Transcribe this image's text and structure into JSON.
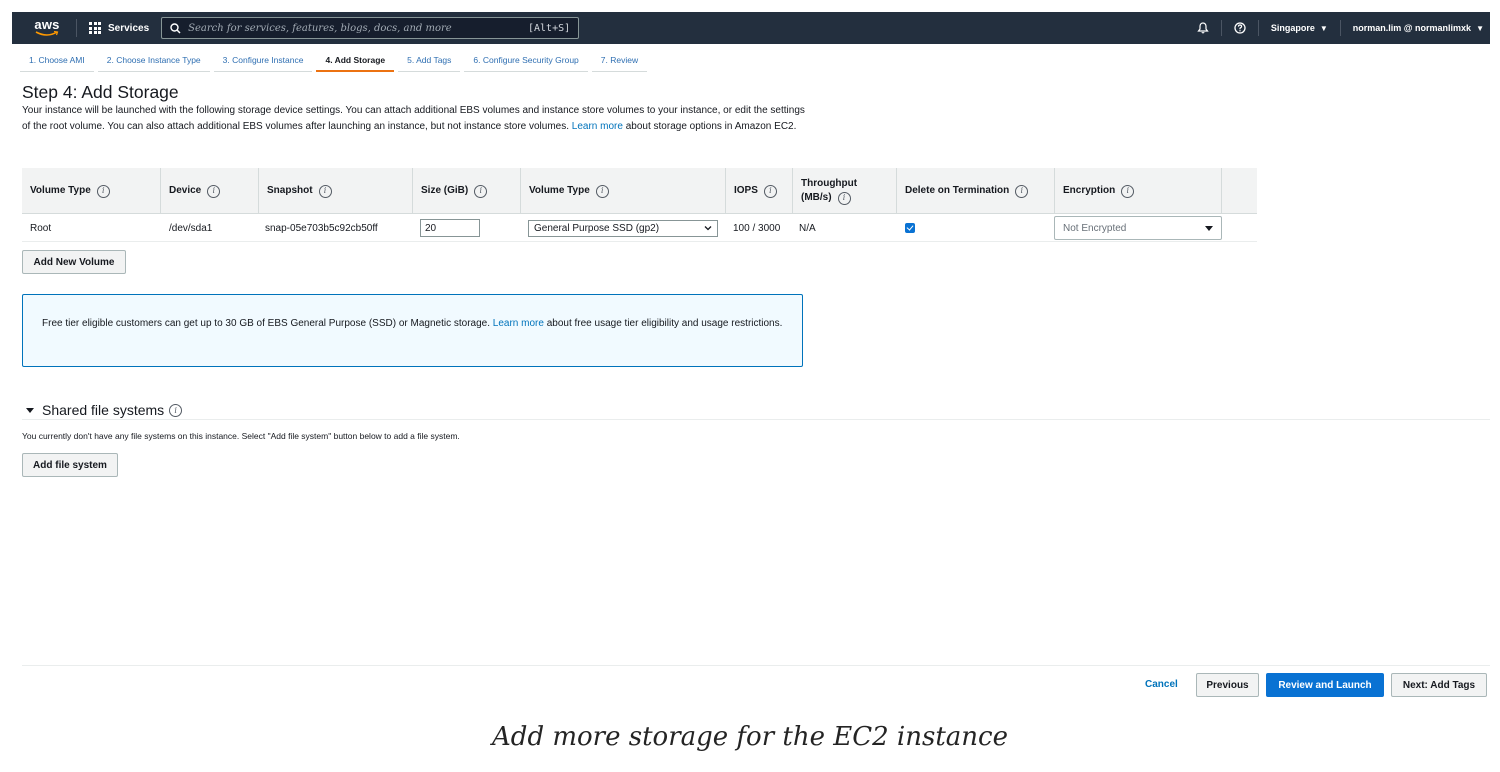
{
  "topnav": {
    "logo_text": "aws",
    "services_label": "Services",
    "search_placeholder": "Search for services, features, blogs, docs, and more",
    "search_shortcut": "[Alt+S]",
    "region": "Singapore",
    "account": "norman.lim @ normanlimxk"
  },
  "wizard": {
    "tabs": [
      {
        "label": "1. Choose AMI"
      },
      {
        "label": "2. Choose Instance Type"
      },
      {
        "label": "3. Configure Instance"
      },
      {
        "label": "4. Add Storage"
      },
      {
        "label": "5. Add Tags"
      },
      {
        "label": "6. Configure Security Group"
      },
      {
        "label": "7. Review"
      }
    ],
    "active_index": 3
  },
  "page": {
    "title": "Step 4: Add Storage",
    "intro": "Your instance will be launched with the following storage device settings. You can attach additional EBS volumes and instance store volumes to your instance, or edit the settings of the root volume. You can also attach additional EBS volumes after launching an instance, but not instance store volumes.",
    "intro_link": "Learn more",
    "intro_tail": "about storage options in Amazon EC2."
  },
  "storage_table": {
    "headers": {
      "volume_type": "Volume Type",
      "device": "Device",
      "snapshot": "Snapshot",
      "size": "Size (GiB)",
      "volume_type2": "Volume Type",
      "iops": "IOPS",
      "throughput_1": "Throughput",
      "throughput_2": "(MB/s)",
      "delete_on_termination": "Delete on Termination",
      "encryption": "Encryption"
    },
    "rows": [
      {
        "volume_type": "Root",
        "device": "/dev/sda1",
        "snapshot": "snap-05e703b5c92cb50ff",
        "size": "20",
        "volume_type_select": "General Purpose SSD (gp2)",
        "iops": "100 / 3000",
        "throughput": "N/A",
        "delete_on_termination": true,
        "encryption": "Not Encrypted"
      }
    ],
    "info_glyph": "i"
  },
  "buttons": {
    "add_new_volume": "Add New Volume",
    "add_file_system": "Add file system",
    "cancel": "Cancel",
    "previous": "Previous",
    "review_and_launch": "Review and Launch",
    "next": "Next: Add Tags"
  },
  "notice": {
    "text": "Free tier eligible customers can get up to 30 GB of EBS General Purpose (SSD) or Magnetic storage.",
    "link": "Learn more",
    "tail": "about free usage tier eligibility and usage restrictions."
  },
  "shared_fs": {
    "title": "Shared file systems",
    "message": "You currently don't have any file systems on this instance. Select \"Add file system\" button below to add a file system."
  },
  "caption": "Add more storage for the EC2 instance",
  "colors": {
    "nav_bg": "#232f3e",
    "accent_orange": "#ec7211",
    "primary_blue": "#0972d3",
    "link_blue": "#0073bb"
  }
}
